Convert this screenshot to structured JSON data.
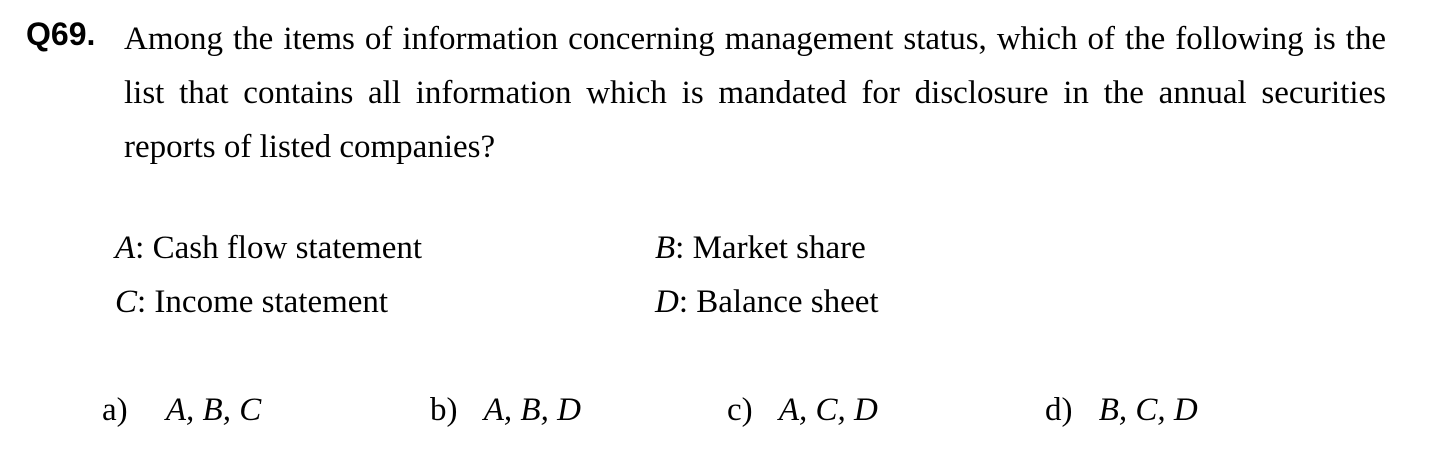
{
  "question": {
    "number": "Q69.",
    "text": "Among the items of information concerning management status, which of the following is the list that contains all information which is mandated for disclosure in the annual securities reports of listed companies?"
  },
  "items": [
    {
      "letter": "A",
      "label": ": Cash flow statement"
    },
    {
      "letter": "B",
      "label": ": Market share"
    },
    {
      "letter": "C",
      "label": ": Income statement"
    },
    {
      "letter": "D",
      "label": ": Balance sheet"
    }
  ],
  "options": [
    {
      "key": "a)",
      "value": "A, B, C"
    },
    {
      "key": "b)",
      "value": "A, B, D"
    },
    {
      "key": "c)",
      "value": "A, C, D"
    },
    {
      "key": "d)",
      "value": "B, C, D"
    }
  ]
}
